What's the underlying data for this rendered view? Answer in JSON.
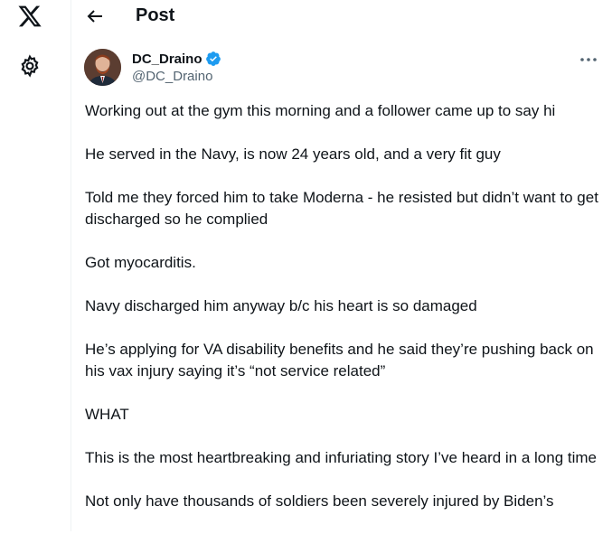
{
  "header": {
    "title": "Post"
  },
  "author": {
    "display_name": "DC_Draino",
    "handle": "@DC_Draino"
  },
  "tweet": {
    "paragraphs": [
      "Working out at the gym this morning and a follower came up to say hi",
      "He served in the Navy, is now 24 years old, and a very fit guy",
      "Told me they forced him to take Moderna - he resisted but didn’t want to get discharged so he complied",
      "Got myocarditis.",
      "Navy discharged him anyway b/c his heart is so damaged",
      "He’s applying for VA disability benefits and he said they’re pushing back on his vax injury saying it’s “not service related”",
      "WHAT",
      "This is the most heartbreaking and infuriating story I’ve heard in a long time",
      "Not only have thousands of soldiers been severely injured by Biden’s"
    ]
  },
  "icons": {
    "logo": "x-logo-icon",
    "settings": "gear-icon",
    "back": "back-arrow-icon",
    "verified": "verified-badge-icon",
    "more": "more-icon"
  },
  "colors": {
    "verified": "#1d9bf0",
    "text": "#0f1419",
    "muted": "#536471"
  }
}
